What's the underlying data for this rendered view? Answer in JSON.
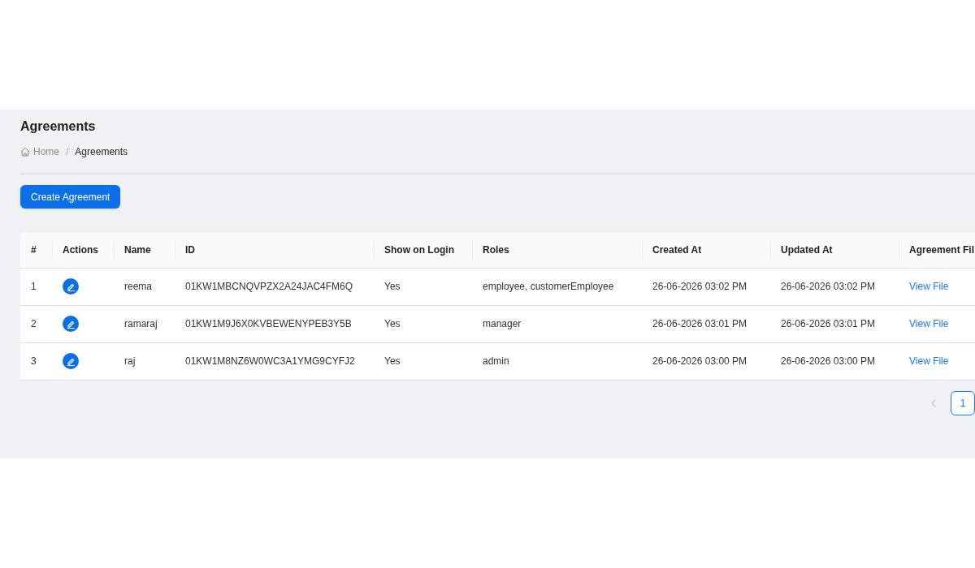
{
  "page": {
    "title": "Agreements"
  },
  "breadcrumb": {
    "separator": "/",
    "items": [
      {
        "label": "Home",
        "kind": "home"
      },
      {
        "label": "Agreements",
        "kind": "current"
      }
    ]
  },
  "create_button": {
    "label": "Create Agreement"
  },
  "table": {
    "columns": [
      "#",
      "Actions",
      "Name",
      "ID",
      "Show on Login",
      "Roles",
      "Created At",
      "Updated At",
      "Agreement Fil"
    ],
    "rows": [
      {
        "index": "1",
        "name": "reema",
        "id": "01KW1MBCNQVPZX2A24JAC4FM6Q",
        "show_on_login": "Yes",
        "roles": "employee, customerEmployee",
        "created_at": "26-06-2026 03:02 PM",
        "updated_at": "26-06-2026 03:02 PM",
        "file_link": "View File"
      },
      {
        "index": "2",
        "name": "ramaraj",
        "id": "01KW1M9J6X0KVBEWENYPEB3Y5B",
        "show_on_login": "Yes",
        "roles": "manager",
        "created_at": "26-06-2026 03:01 PM",
        "updated_at": "26-06-2026 03:01 PM",
        "file_link": "View File"
      },
      {
        "index": "3",
        "name": "raj",
        "id": "01KW1M8NZ6W0WC3A1YMG9CYFJ2",
        "show_on_login": "Yes",
        "roles": "admin",
        "created_at": "26-06-2026 03:00 PM",
        "updated_at": "26-06-2026 03:00 PM",
        "file_link": "View File"
      }
    ]
  },
  "pagination": {
    "prev": {
      "disabled": true
    },
    "pages": [
      {
        "label": "1",
        "selected": true
      }
    ]
  }
}
